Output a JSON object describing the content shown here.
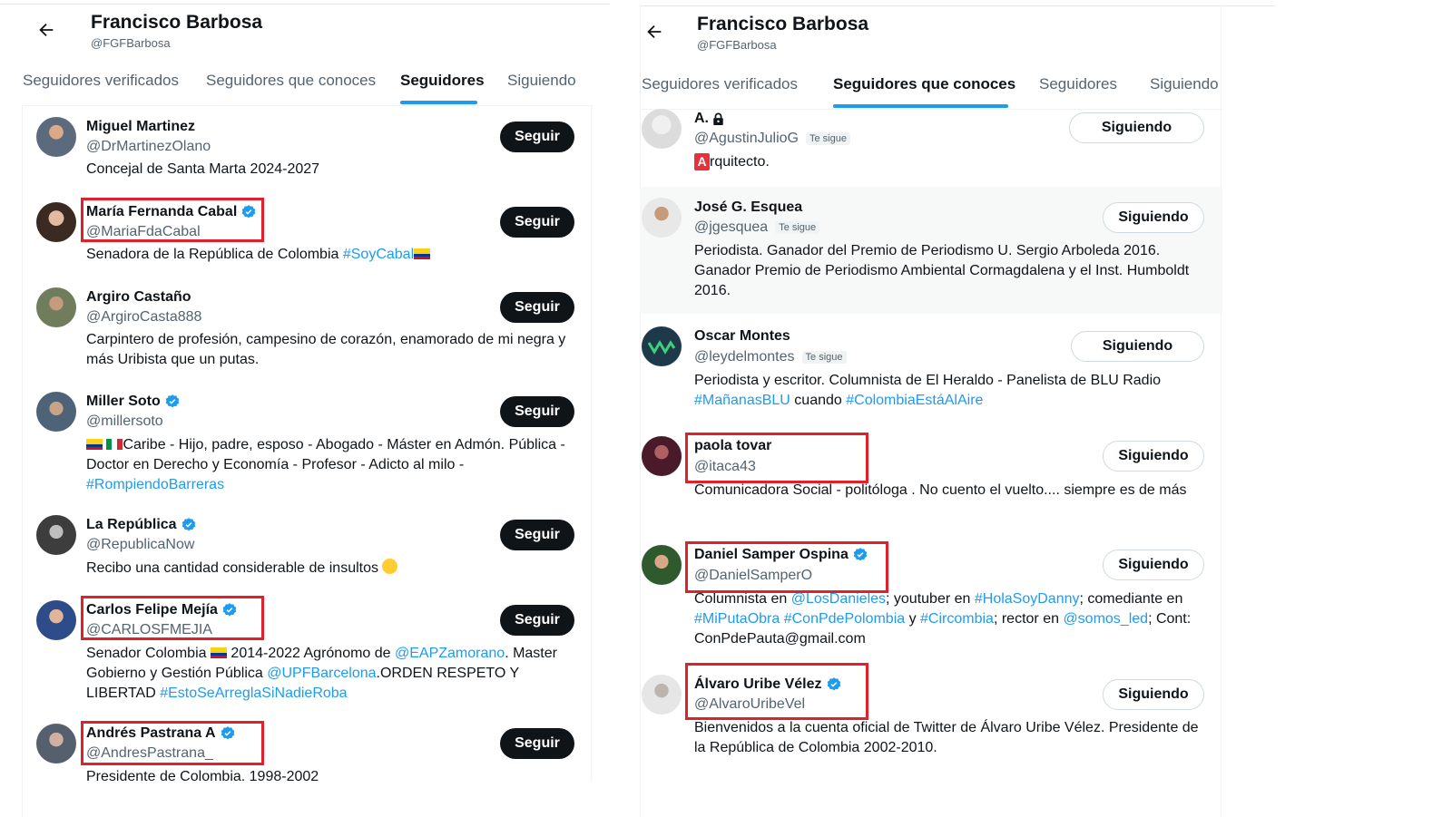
{
  "colors": {
    "accent": "#1d9bf0",
    "highlight": "#e0202a",
    "follow_bg": "#0f1419"
  },
  "left": {
    "header": {
      "title": "Francisco Barbosa",
      "handle": "@FGFBarbosa"
    },
    "tabs": [
      {
        "label": "Seguidores verificados",
        "active": false
      },
      {
        "label": "Seguidores que conoces",
        "active": false
      },
      {
        "label": "Seguidores",
        "active": true
      },
      {
        "label": "Siguiendo",
        "active": false
      }
    ],
    "users": [
      {
        "name": "Miguel Martinez",
        "handle": "@DrMartinezOlano",
        "verified": false,
        "button": "Seguir",
        "highlighted": false,
        "bio": "Concejal de Santa Marta 2024-2027"
      },
      {
        "name": "María Fernanda Cabal",
        "handle": "@MariaFdaCabal",
        "verified": true,
        "button": "Seguir",
        "highlighted": true,
        "bio_text": "Senadora de la República de Colombia ",
        "bio_link": "#SoyCabal"
      },
      {
        "name": "Argiro Castaño",
        "handle": "@ArgiroCasta888",
        "verified": false,
        "button": "Seguir",
        "highlighted": false,
        "bio": "Carpintero de profesión, campesino de corazón, enamorado de mi negra y más Uribista que un putas."
      },
      {
        "name": "Miller Soto",
        "handle": "@millersoto",
        "verified": true,
        "button": "Seguir",
        "highlighted": false,
        "bio_text": "Caribe - Hijo, padre, esposo - Abogado - Máster en Admón. Pública - Doctor en Derecho y Economía - Profesor - Adicto al milo -",
        "bio_link": "#RompiendoBarreras"
      },
      {
        "name": "La República",
        "handle": "@RepublicaNow",
        "verified": true,
        "button": "Seguir",
        "highlighted": false,
        "bio": "Recibo una cantidad considerable de insultos"
      },
      {
        "name": "Carlos Felipe Mejía",
        "handle": "@CARLOSFMEJIA",
        "verified": true,
        "button": "Seguir",
        "highlighted": true,
        "bio_1": "Senador Colombia ",
        "bio_2": " 2014-2022 Agrónomo de ",
        "bio_link1": "@EAPZamorano",
        "bio_3": ". Master Gobierno y Gestión Pública ",
        "bio_link2": "@UPFBarcelona",
        "bio_4": ".ORDEN RESPETO Y LIBERTAD",
        "bio_link3": "#EstoSeArreglaSiNadieRoba"
      },
      {
        "name": "Andrés Pastrana A",
        "handle": "@AndresPastrana_",
        "verified": true,
        "button": "Seguir",
        "highlighted": true,
        "bio": "Presidente de Colombia. 1998-2002"
      }
    ]
  },
  "right": {
    "header": {
      "title": "Francisco Barbosa",
      "handle": "@FGFBarbosa"
    },
    "tabs": [
      {
        "label": "Seguidores verificados",
        "active": false
      },
      {
        "label": "Seguidores que conoces",
        "active": true
      },
      {
        "label": "Seguidores",
        "active": false
      },
      {
        "label": "Siguiendo",
        "active": false
      }
    ],
    "follows_you": "Te sigue",
    "users": [
      {
        "name": "A.",
        "handle": "@AgustinJulioG",
        "follows_you": true,
        "button": "Siguiendo",
        "highlighted": false,
        "bio_box": "A",
        "bio": "rquitecto."
      },
      {
        "name": "José G. Esquea",
        "handle": "@jgesquea",
        "follows_you": true,
        "button": "Siguiendo",
        "highlighted": false,
        "bio": "Periodista. Ganador del Premio de Periodismo U. Sergio Arboleda 2016. Ganador Premio de Periodismo Ambiental Cormagdalena y el Inst. Humboldt 2016."
      },
      {
        "name": "Oscar Montes",
        "handle": "@leydelmontes",
        "follows_you": true,
        "button": "Siguiendo",
        "highlighted": false,
        "bio_text": "Periodista y escritor. Columnista de El Heraldo - Panelista de BLU Radio ",
        "bio_link1": "#MañanasBLU",
        "bio_mid": " cuando ",
        "bio_link2": "#ColombiaEstáAlAire"
      },
      {
        "name": "paola tovar",
        "handle": "@itaca43",
        "follows_you": false,
        "button": "Siguiendo",
        "highlighted": true,
        "bio": "Comunicadora Social - politóloga . No cuento el vuelto.... siempre es de más"
      },
      {
        "name": "Daniel Samper Ospina",
        "handle": "@DanielSamperO",
        "verified": true,
        "button": "Siguiendo",
        "highlighted": true,
        "b1": "Columnista en ",
        "l1": "@LosDanieles",
        "b2": "; youtuber en ",
        "l2": "#HolaSoyDanny",
        "b3": "; comediante en ",
        "l3": "#MiPutaObra",
        "b4": " ",
        "l4": "#ConPdePolombia",
        "b5": " y ",
        "l5": "#Circombia",
        "b6": "; rector en ",
        "l6": "@somos_led",
        "b7": "; Cont: ConPdePauta@gmail.com"
      },
      {
        "name": "Álvaro Uribe Vélez",
        "handle": "@AlvaroUribeVel",
        "verified": true,
        "button": "Siguiendo",
        "highlighted": true,
        "bio": "Bienvenidos a la cuenta oficial de Twitter de Álvaro Uribe Vélez. Presidente de la República de Colombia 2002-2010."
      }
    ]
  }
}
